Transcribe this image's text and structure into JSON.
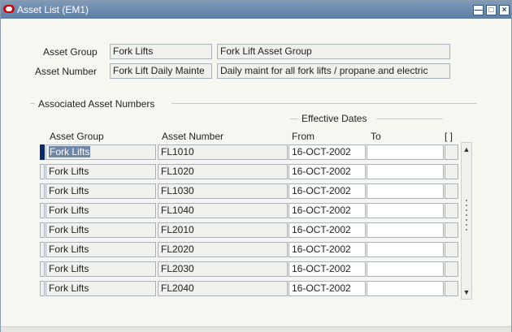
{
  "window": {
    "title": "Asset List (EM1)",
    "minimize_glyph": "—",
    "maximize_glyph": "□",
    "close_glyph": "×"
  },
  "header": {
    "asset_group_label": "Asset Group",
    "asset_group_value": "Fork Lifts",
    "asset_group_desc": "Fork Lift Asset Group",
    "asset_number_label": "Asset Number",
    "asset_number_value": "Fork Lift Daily Mainte",
    "asset_number_desc": "Daily maint for all fork lifts / propane and electric"
  },
  "associated": {
    "section_title": "Associated Asset Numbers",
    "effective_dates_label": "Effective Dates",
    "col_asset_group": "Asset Group",
    "col_asset_number": "Asset Number",
    "col_from": "From",
    "col_to": "To",
    "col_flex": "[ ]",
    "rows": [
      {
        "group": "Fork Lifts",
        "number": "FL1010",
        "from": "16-OCT-2002",
        "to": ""
      },
      {
        "group": "Fork Lifts",
        "number": "FL1020",
        "from": "16-OCT-2002",
        "to": ""
      },
      {
        "group": "Fork Lifts",
        "number": "FL1030",
        "from": "16-OCT-2002",
        "to": ""
      },
      {
        "group": "Fork Lifts",
        "number": "FL1040",
        "from": "16-OCT-2002",
        "to": ""
      },
      {
        "group": "Fork Lifts",
        "number": "FL2010",
        "from": "16-OCT-2002",
        "to": ""
      },
      {
        "group": "Fork Lifts",
        "number": "FL2020",
        "from": "16-OCT-2002",
        "to": ""
      },
      {
        "group": "Fork Lifts",
        "number": "FL2030",
        "from": "16-OCT-2002",
        "to": ""
      },
      {
        "group": "Fork Lifts",
        "number": "FL2040",
        "from": "16-OCT-2002",
        "to": ""
      }
    ]
  },
  "colors": {
    "title_bar": "#5d7ea4",
    "selection": "#6f86a6",
    "current_row_indicator": "#0b2a6e"
  }
}
